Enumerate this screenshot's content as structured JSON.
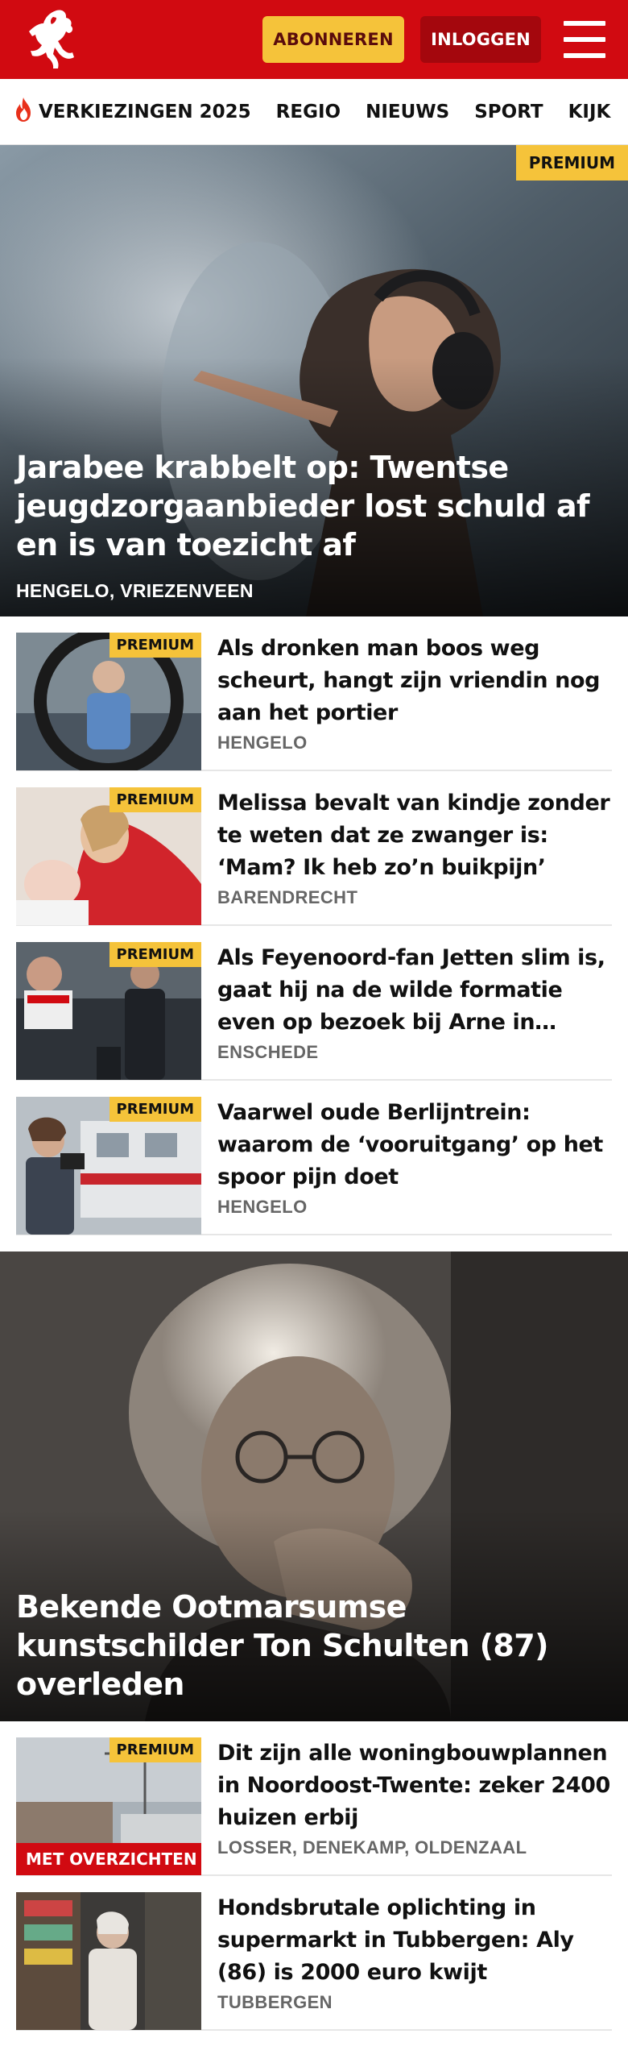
{
  "header": {
    "subscribe_label": "ABONNEREN",
    "login_label": "INLOGGEN"
  },
  "nav": {
    "items": [
      "VERKIEZINGEN 2025",
      "REGIO",
      "NIEUWS",
      "SPORT",
      "KIJK"
    ]
  },
  "hero1": {
    "badge": "PREMIUM",
    "title": "Jarabee krabbelt op: Twentse jeugdzorgaanbieder lost schuld af en is van toezicht af",
    "location": "HENGELO, VRIEZENVEEN"
  },
  "list1": [
    {
      "badge": "PREMIUM",
      "title": "Als dronken man boos weg scheurt, hangt zijn vriendin nog aan het portier",
      "location": "HENGELO"
    },
    {
      "badge": "PREMIUM",
      "title": "Melissa bevalt van kindje zonder te weten dat ze zwanger is: ‘Mam? Ik heb zo’n buikpijn’",
      "location": "BARENDRECHT"
    },
    {
      "badge": "PREMIUM",
      "title": "Als Feyenoord-fan Jetten slim is, gaat hij na de wilde formatie even op bezoek bij Arne in…",
      "location": "ENSCHEDE"
    },
    {
      "badge": "PREMIUM",
      "title": "Vaarwel oude Berlijntrein: waarom de ‘vooruitgang’ op het spoor pijn doet",
      "location": "HENGELO"
    }
  ],
  "hero2": {
    "title": "Bekende Ootmarsumse kunstschilder Ton Schulten (87) overleden"
  },
  "list2": [
    {
      "badge": "PREMIUM",
      "red_badge": "MET OVERZICHTEN",
      "title": "Dit zijn alle woningbouwplannen in Noordoost-Twente: zeker 2400 huizen erbij",
      "location": "LOSSER, DENEKAMP, OLDENZAAL"
    },
    {
      "title": "Hondsbrutale oplichting in supermarkt in Tubbergen: Aly (86) is 2000 euro kwijt",
      "location": "TUBBERGEN"
    }
  ],
  "colors": {
    "brand_red": "#d10a11",
    "premium_yellow": "#f5c33a"
  }
}
